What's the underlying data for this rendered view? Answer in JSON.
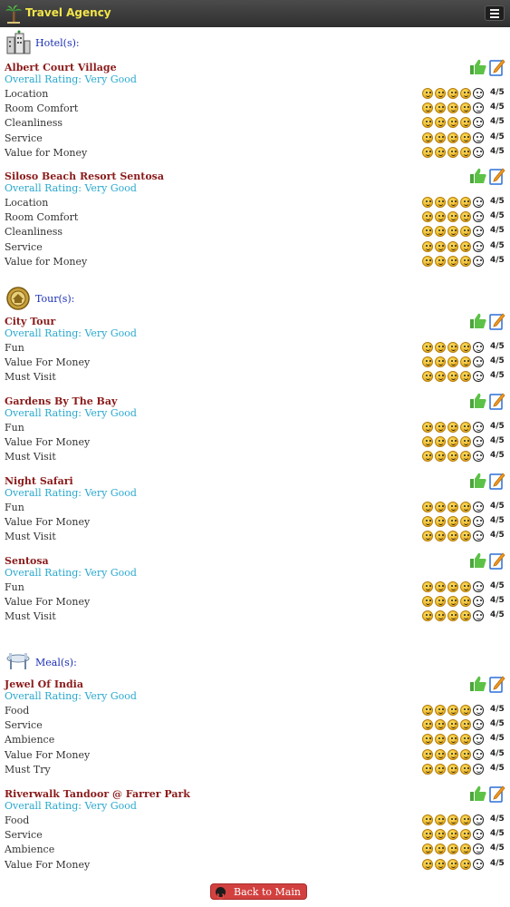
{
  "app": {
    "brand": "Travel Agency",
    "back_label": "Back to Main"
  },
  "icons": {
    "logo": "palm-tree-icon",
    "menu": "hamburger-menu-icon",
    "like": "thumbs-up-icon",
    "edit": "edit-note-icon",
    "back": "back-arrow-icon",
    "hotel": "hotel-building-icon",
    "tour": "tour-badge-icon",
    "meal": "meal-table-icon"
  },
  "colors": {
    "title": "#8b1a1a",
    "overall": "#2aa9cf",
    "section": "#1a2fb5",
    "button": "#d2413f"
  },
  "sections": [
    {
      "title": "Hotel(s):",
      "icon": "hotel-building-icon",
      "items": [
        {
          "name": "Albert Court Village",
          "overall_label": "Overall Rating:",
          "overall_value": "Very Good",
          "criteria": [
            {
              "label": "Location",
              "score": "4/5",
              "value": 4
            },
            {
              "label": "Room Comfort",
              "score": "4/5",
              "value": 4
            },
            {
              "label": "Cleanliness",
              "score": "4/5",
              "value": 4
            },
            {
              "label": "Service",
              "score": "4/5",
              "value": 4
            },
            {
              "label": "Value for Money",
              "score": "4/5",
              "value": 4
            }
          ]
        },
        {
          "name": "Siloso Beach Resort Sentosa",
          "overall_label": "Overall Rating:",
          "overall_value": "Very Good",
          "criteria": [
            {
              "label": "Location",
              "score": "4/5",
              "value": 4
            },
            {
              "label": "Room Comfort",
              "score": "4/5",
              "value": 4
            },
            {
              "label": "Cleanliness",
              "score": "4/5",
              "value": 4
            },
            {
              "label": "Service",
              "score": "4/5",
              "value": 4
            },
            {
              "label": "Value for Money",
              "score": "4/5",
              "value": 4
            }
          ]
        }
      ]
    },
    {
      "title": "Tour(s):",
      "icon": "tour-badge-icon",
      "items": [
        {
          "name": "City Tour",
          "overall_label": "Overall Rating:",
          "overall_value": "Very Good",
          "criteria": [
            {
              "label": "Fun",
              "score": "4/5",
              "value": 4
            },
            {
              "label": "Value For Money",
              "score": "4/5",
              "value": 4
            },
            {
              "label": "Must Visit",
              "score": "4/5",
              "value": 4
            }
          ]
        },
        {
          "name": "Gardens By The Bay",
          "overall_label": "Overall Rating:",
          "overall_value": "Very Good",
          "criteria": [
            {
              "label": "Fun",
              "score": "4/5",
              "value": 4
            },
            {
              "label": "Value For Money",
              "score": "4/5",
              "value": 4
            },
            {
              "label": "Must Visit",
              "score": "4/5",
              "value": 4
            }
          ]
        },
        {
          "name": "Night Safari",
          "overall_label": "Overall Rating:",
          "overall_value": "Very Good",
          "criteria": [
            {
              "label": "Fun",
              "score": "4/5",
              "value": 4
            },
            {
              "label": "Value For Money",
              "score": "4/5",
              "value": 4
            },
            {
              "label": "Must Visit",
              "score": "4/5",
              "value": 4
            }
          ]
        },
        {
          "name": "Sentosa",
          "overall_label": "Overall Rating:",
          "overall_value": "Very Good",
          "criteria": [
            {
              "label": "Fun",
              "score": "4/5",
              "value": 4
            },
            {
              "label": "Value For Money",
              "score": "4/5",
              "value": 4
            },
            {
              "label": "Must Visit",
              "score": "4/5",
              "value": 4
            }
          ]
        }
      ]
    },
    {
      "title": "Meal(s):",
      "icon": "meal-table-icon",
      "items": [
        {
          "name": "Jewel Of India",
          "overall_label": "Overall Rating:",
          "overall_value": "Very Good",
          "criteria": [
            {
              "label": "Food",
              "score": "4/5",
              "value": 4
            },
            {
              "label": "Service",
              "score": "4/5",
              "value": 4
            },
            {
              "label": "Ambience",
              "score": "4/5",
              "value": 4
            },
            {
              "label": "Value For Money",
              "score": "4/5",
              "value": 4
            },
            {
              "label": "Must Try",
              "score": "4/5",
              "value": 4
            }
          ]
        },
        {
          "name": "Riverwalk Tandoor @ Farrer Park",
          "overall_label": "Overall Rating:",
          "overall_value": "Very Good",
          "criteria": [
            {
              "label": "Food",
              "score": "4/5",
              "value": 4
            },
            {
              "label": "Service",
              "score": "4/5",
              "value": 4
            },
            {
              "label": "Ambience",
              "score": "4/5",
              "value": 4
            },
            {
              "label": "Value For Money",
              "score": "4/5",
              "value": 4
            }
          ]
        }
      ]
    }
  ]
}
